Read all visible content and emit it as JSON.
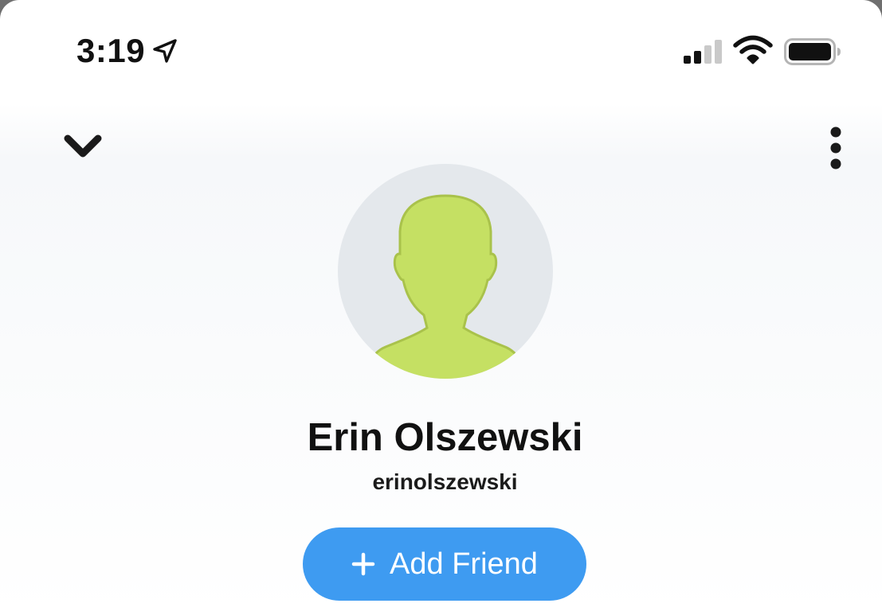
{
  "status_bar": {
    "time": "3:19",
    "icons": [
      "location-arrow-icon",
      "cellular-signal-icon",
      "wifi-icon",
      "battery-icon"
    ]
  },
  "header": {
    "collapse_icon": "chevron-down-icon",
    "menu_icon": "more-vertical-icon"
  },
  "profile": {
    "avatar_icon": "default-avatar-silhouette",
    "display_name": "Erin Olszewski",
    "username": "erinolszewski"
  },
  "actions": {
    "add_friend_label": "Add Friend",
    "add_friend_icon": "plus-icon"
  },
  "colors": {
    "accent_blue": "#3e9bf1",
    "avatar_bg": "#e4e8ec",
    "avatar_silhouette": "#c5e063",
    "text_primary": "#111111"
  }
}
